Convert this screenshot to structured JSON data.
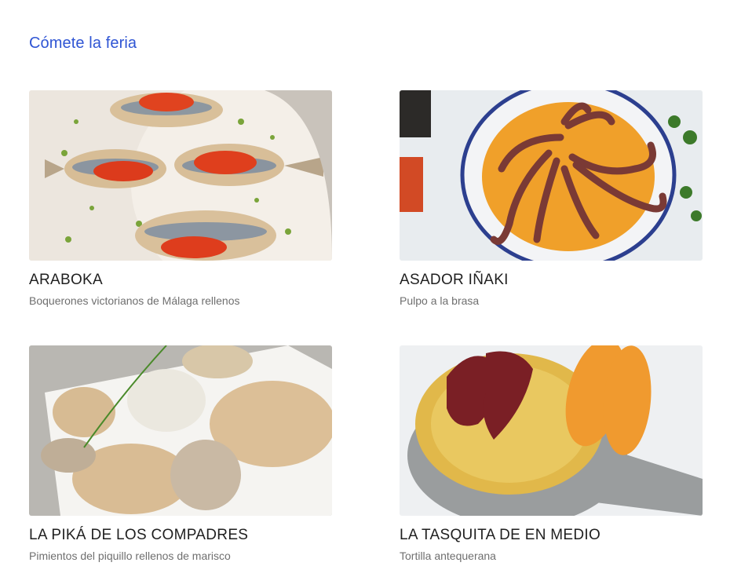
{
  "section": {
    "title": "Cómete la feria"
  },
  "cards": [
    {
      "name": "ARABOKA",
      "description": "Boquerones victorianos de Málaga rellenos"
    },
    {
      "name": "ASADOR IÑAKI",
      "description": "Pulpo a la brasa"
    },
    {
      "name": "LA PIKÁ DE LOS COMPADRES",
      "description": "Pimientos del piquillo rellenos de marisco"
    },
    {
      "name": "LA TASQUITA DE EN MEDIO",
      "description": "Tortilla antequerana"
    }
  ],
  "colors": {
    "accent": "#2f55d4",
    "name": "#1f1f1f",
    "description": "#6f6f6f"
  }
}
